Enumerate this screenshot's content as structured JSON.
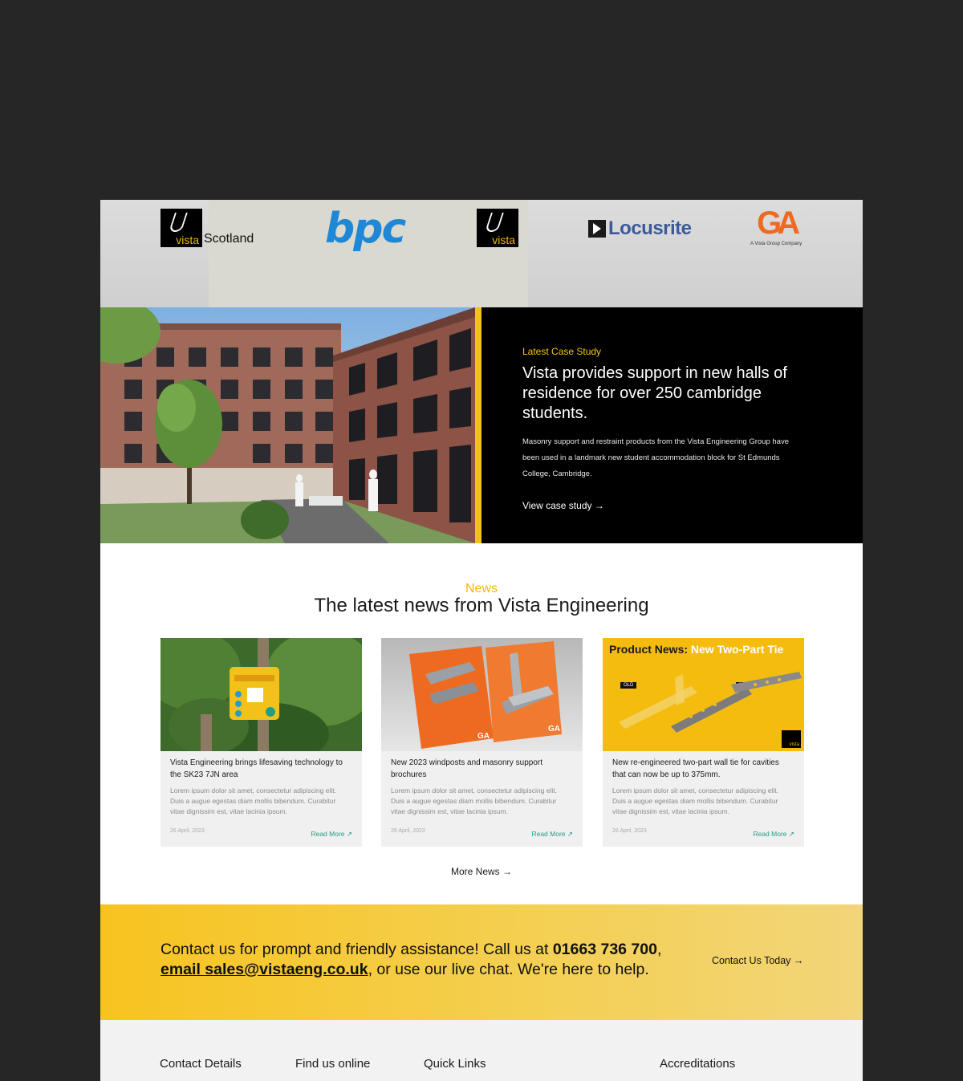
{
  "brands": {
    "vista_scotland_word": "vista",
    "vista_scotland_suffix": "Scotland",
    "bpc": "bpc",
    "vista_word": "vista",
    "locusrite": "Locusrite",
    "ga_logo": "GA",
    "ga_sub": "A Vista Group Company"
  },
  "case_study": {
    "tag": "Latest Case Study",
    "title": "Vista provides support in new halls of residence for over 250 cambridge students.",
    "text": "Masonry support and restraint products from the Vista Engineering Group have been used in a landmark new student accommodation block for St Edmunds College, Cambridge.",
    "link": "View case study →"
  },
  "news": {
    "tag": "News",
    "title": "The latest news from Vista Engineering",
    "items": [
      {
        "title": "Vista Engineering brings lifesaving technology to the SK23 7JN area",
        "excerpt": "Lorem ipsum dolor sit amet, consectetur adipiscing elit. Duis a augue egestas diam mollis bibendum. Curabitur vitae dignissim est, vitae lacinia ipsum.",
        "date": "26 April, 2023",
        "more": "Read More ↗"
      },
      {
        "title": "New 2023 windposts and masonry support brochures",
        "excerpt": "Lorem ipsum dolor sit amet, consectetur adipiscing elit. Duis a augue egestas diam mollis bibendum. Curabitur vitae dignissim est, vitae lacinia ipsum.",
        "date": "26 April, 2023",
        "more": "Read More ↗"
      },
      {
        "title": "New re-engineered two-part wall tie for cavities that can now be up to 375mm.",
        "excerpt": "Lorem ipsum dolor sit amet, consectetur adipiscing elit. Duis a augue egestas diam mollis bibendum. Curabitur vitae dignissim est, vitae lacinia ipsum.",
        "date": "26 April, 2023",
        "more": "Read More ↗"
      }
    ],
    "product_banner_label": "Product News:",
    "product_banner_highlight": "New Two-Part Tie",
    "tag_old": "OLD",
    "tag_new": "New",
    "product_vista_word": "vista",
    "more_news": "More News →"
  },
  "contact": {
    "text_1": "Contact us for prompt and friendly assistance! Call us at ",
    "phone": "01663 736 700",
    "text_2": ",",
    "email": "email sales@vistaeng.co.uk",
    "text_3": ", or use our live chat. We're here to help.",
    "button": "Contact Us Today →"
  },
  "footer": {
    "col1": "Contact Details",
    "col2": "Find us online",
    "col3": "Quick Links",
    "col4": "Accreditations"
  },
  "colors": {
    "background": "#262626",
    "accent": "#f2c21b",
    "link_teal": "#1f9e88",
    "bpc_blue": "#1e88d6",
    "locusrite_blue": "#3d5a98",
    "ga_orange": "#ee6a21"
  }
}
